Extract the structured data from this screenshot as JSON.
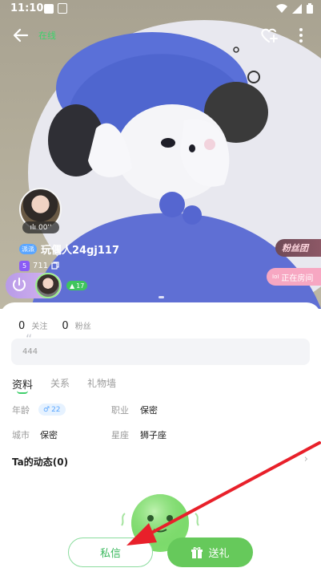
{
  "status_bar": {
    "time": "11:10"
  },
  "topbar": {
    "online_text": "在线"
  },
  "profile": {
    "voice_duration": "00''",
    "vip_badge": "派派",
    "username": "玩偶人24gj117",
    "level_badge": "5",
    "wealth_value": "711",
    "fans_count": "17"
  },
  "right_badges": {
    "fan_club": "粉丝团",
    "in_room_icon": "IoI",
    "in_room": "正在房间"
  },
  "stats": {
    "following_count": "0",
    "following_label": "关注",
    "fans_count": "0",
    "fans_label": "粉丝"
  },
  "signature": {
    "quote_mark": "“",
    "text": "444"
  },
  "tabs": [
    {
      "label": "资料"
    },
    {
      "label": "关系"
    },
    {
      "label": "礼物墙"
    }
  ],
  "info": {
    "age_label": "年龄",
    "age_value": "22",
    "job_label": "职业",
    "job_value": "保密",
    "city_label": "城市",
    "city_value": "保密",
    "zodiac_label": "星座",
    "zodiac_value": "狮子座"
  },
  "moments": {
    "title": "Ta的动态(0)",
    "arrow": "›"
  },
  "actions": {
    "message_label": "私信",
    "gift_label": "送礼"
  },
  "colors": {
    "accent_green": "#66c95b",
    "annotation_red": "#e8202a"
  }
}
